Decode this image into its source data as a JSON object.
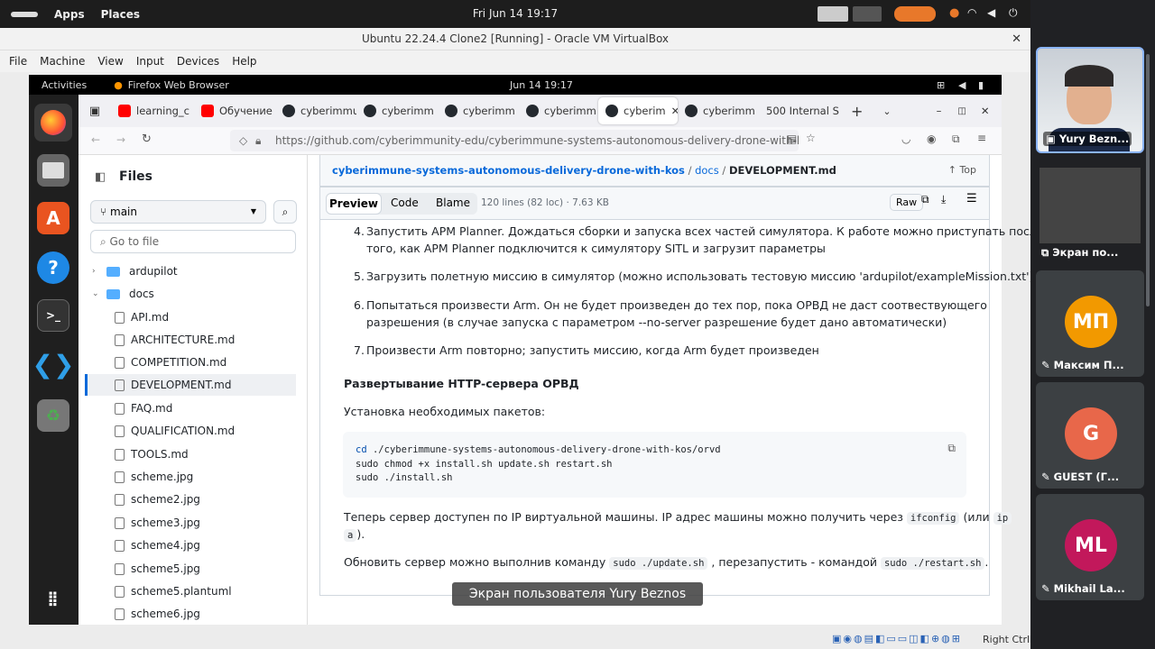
{
  "host": {
    "apps": "Apps",
    "places": "Places",
    "clock": "Fri Jun 14  19:17"
  },
  "vbox": {
    "title": "Ubuntu 22.24.4 Clone2 [Running] - Oracle VM VirtualBox",
    "menu": [
      "File",
      "Machine",
      "View",
      "Input",
      "Devices",
      "Help"
    ],
    "hostkey": "Right Ctrl"
  },
  "ubuntu": {
    "activities": "Activities",
    "app": "Firefox Web Browser",
    "clock": "Jun 14  19:17"
  },
  "tabs": [
    {
      "label": "learning_c",
      "icon": "youtube-icon",
      "color": "#ff0000"
    },
    {
      "label": "Обучение",
      "icon": "youtube-icon",
      "color": "#ff0000"
    },
    {
      "label": "cyberimmu",
      "icon": "github-icon",
      "color": "#24292f"
    },
    {
      "label": "cyberimm",
      "icon": "github-icon",
      "color": "#24292f"
    },
    {
      "label": "cyberimm",
      "icon": "github-icon",
      "color": "#24292f"
    },
    {
      "label": "cyberimm",
      "icon": "github-icon",
      "color": "#24292f"
    },
    {
      "label": "cyberim",
      "icon": "github-icon",
      "color": "#24292f"
    },
    {
      "label": "cyberimm",
      "icon": "github-icon",
      "color": "#24292f"
    },
    {
      "label": "500 Internal S",
      "icon": "",
      "color": ""
    }
  ],
  "url": "https://github.com/cyberimmunity-edu/cyberimmune-systems-autonomous-delivery-drone-with-kos/",
  "sidebar": {
    "title": "Files",
    "branch": "main",
    "search_placeholder": "Go to file",
    "items": [
      {
        "label": "ardupilot",
        "type": "folder"
      },
      {
        "label": "docs",
        "type": "folder"
      },
      {
        "label": "API.md",
        "type": "file"
      },
      {
        "label": "ARCHITECTURE.md",
        "type": "file"
      },
      {
        "label": "COMPETITION.md",
        "type": "file"
      },
      {
        "label": "DEVELOPMENT.md",
        "type": "file"
      },
      {
        "label": "FAQ.md",
        "type": "file"
      },
      {
        "label": "QUALIFICATION.md",
        "type": "file"
      },
      {
        "label": "TOOLS.md",
        "type": "file"
      },
      {
        "label": "scheme.jpg",
        "type": "file"
      },
      {
        "label": "scheme2.jpg",
        "type": "file"
      },
      {
        "label": "scheme3.jpg",
        "type": "file"
      },
      {
        "label": "scheme4.jpg",
        "type": "file"
      },
      {
        "label": "scheme5.jpg",
        "type": "file"
      },
      {
        "label": "scheme5.plantuml",
        "type": "file"
      },
      {
        "label": "scheme6.jpg",
        "type": "file"
      }
    ]
  },
  "breadcrumb": {
    "repo": "cyberimmune-systems-autonomous-delivery-drone-with-kos",
    "sep1": "/",
    "dir": "docs",
    "sep2": "/",
    "file": "DEVELOPMENT.md",
    "top": "Top"
  },
  "filebar": {
    "preview": "Preview",
    "code": "Code",
    "blame": "Blame",
    "meta": "120 lines (82 loc) · 7.63 KB",
    "raw": "Raw"
  },
  "content": {
    "li4": "Запустить APM Planner. Дождаться сборки и запуска всех частей симулятора. К работе можно приступать после",
    "li4b": "того, как APM Planner подключится к симулятору SITL и загрузит параметры",
    "li5": "Загрузить полетную миссию в симулятор (можно использовать тестовую миссию 'ardupilot/exampleMission.txt')",
    "li6": "Попытаться произвести Arm. Он не будет произведен до тех пор, пока ОРВД не даст соотвествующего",
    "li6b": "разрешения (в случае запуска с параметром --no-server разрешение будет дано автоматически)",
    "li7": "Произвести Arm повторно; запустить миссию, когда Arm будет произведен",
    "heading": "Развертывание HTTP-сервера ОРВД",
    "install": "Установка необходимых пакетов:",
    "code1_kw": "cd",
    "code1": " ./cyberimmune-systems-autonomous-delivery-drone-with-kos/orvd",
    "code2": "sudo chmod +x install.sh update.sh restart.sh",
    "code3": "sudo ./install.sh",
    "p1a": "Теперь сервер доступен по IP виртуальной машины. IP адрес машины можно получить через",
    "p1code1": "ifconfig",
    "p1b": "(или",
    "p1code2a": "ip",
    "p1code2b": "a",
    "p1c": ").",
    "p2a": "Обновить сервер можно выполнив команду",
    "p2code1": "sudo ./update.sh",
    "p2b": ", перезапустить - командой",
    "p2code2": "sudo ./restart.sh",
    "p2c": "."
  },
  "caption": "Экран пользователя Yury Beznos",
  "participants": [
    {
      "name": "Yury Bezn...",
      "initials": "",
      "color": "#5f6368"
    },
    {
      "name": "Экран по...",
      "initials": "",
      "color": "#3c4043"
    },
    {
      "name": "Максим П...",
      "initials": "МП",
      "color": "#f29900"
    },
    {
      "name": "GUEST (Г...",
      "initials": "G",
      "color": "#e8674a"
    },
    {
      "name": "Mikhail La...",
      "initials": "ML",
      "color": "#c2185b"
    }
  ]
}
